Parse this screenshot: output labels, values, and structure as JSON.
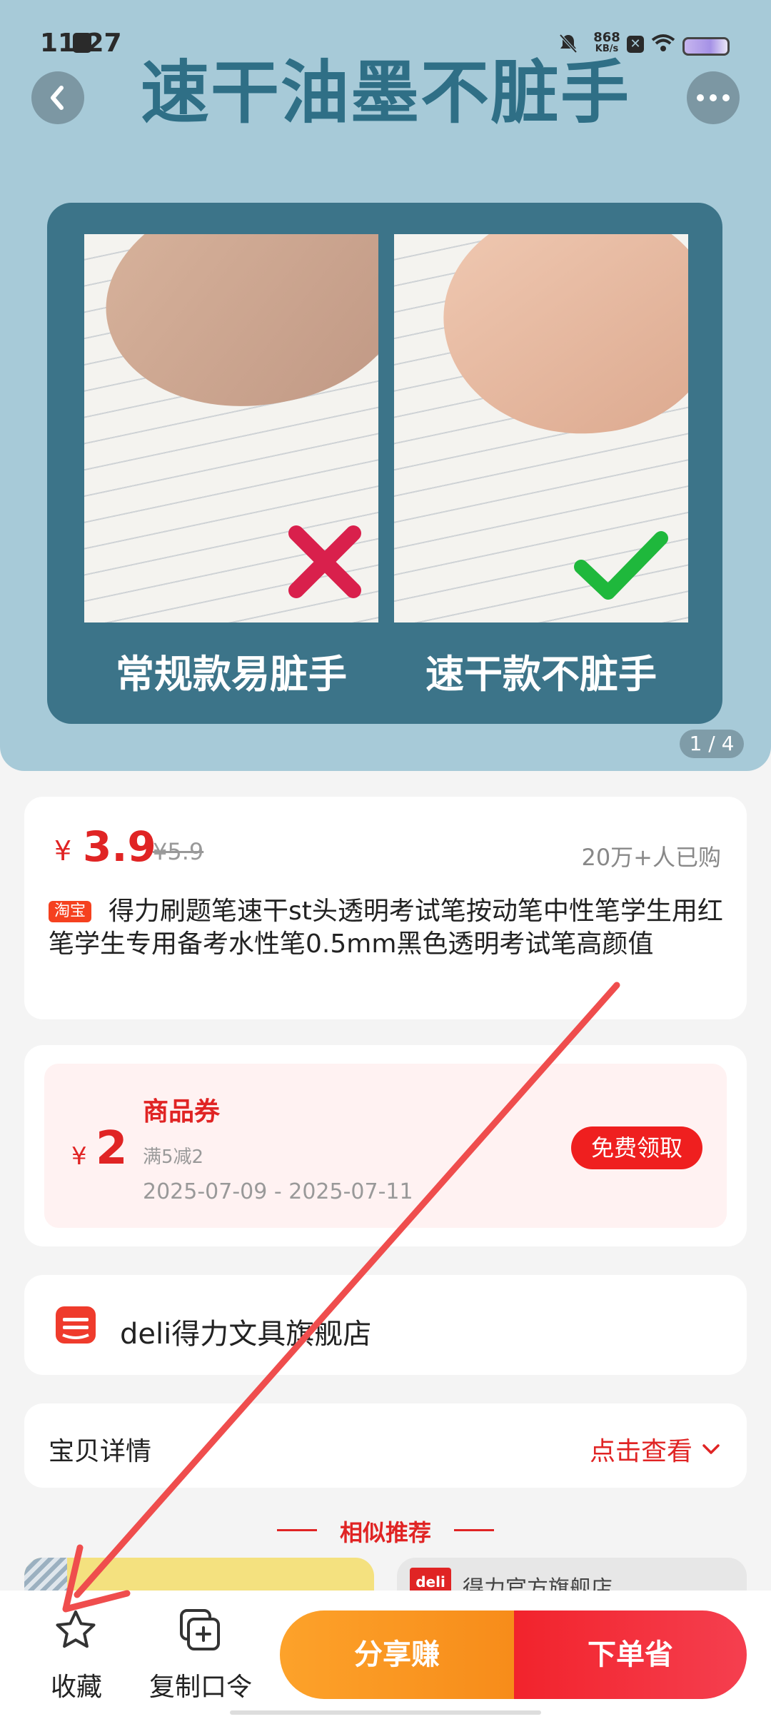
{
  "status_bar": {
    "time": "11:27",
    "network_speed_value": "868",
    "network_speed_unit": "KB/s"
  },
  "hero": {
    "headline": "速干油墨不脏手",
    "left_caption": "常规款易脏手",
    "right_caption": "速干款不脏手",
    "page_indicator": "1 / 4"
  },
  "product": {
    "currency": "¥",
    "price": "3.9",
    "original_price": "¥5.9",
    "sold_count": "20万+人已购",
    "platform_badge": "淘宝",
    "title": "得力刷题笔速干st头透明考试笔按动笔中性笔学生用红笔学生专用备考水性笔0.5mm黑色透明考试笔高颜值"
  },
  "coupon": {
    "currency": "¥",
    "amount": "2",
    "title": "商品券",
    "rule": "满5减2",
    "date_range": "2025-07-09 - 2025-07-11",
    "claim_label": "免费领取"
  },
  "shop": {
    "name": "deli得力文具旗舰店"
  },
  "details": {
    "label": "宝贝详情",
    "action": "点击查看"
  },
  "recommend": {
    "title": "相似推荐",
    "right_card_logo": "deli",
    "right_card_shop": "得力官方旗舰店"
  },
  "bottom_bar": {
    "favorite_label": "收藏",
    "copy_label": "复制口令",
    "share_label": "分享赚",
    "order_label": "下单省"
  },
  "colors": {
    "accent_red": "#e02424",
    "share_orange": "#fda22a",
    "order_red": "#f2232c",
    "hero_bg": "#a7cad8"
  }
}
